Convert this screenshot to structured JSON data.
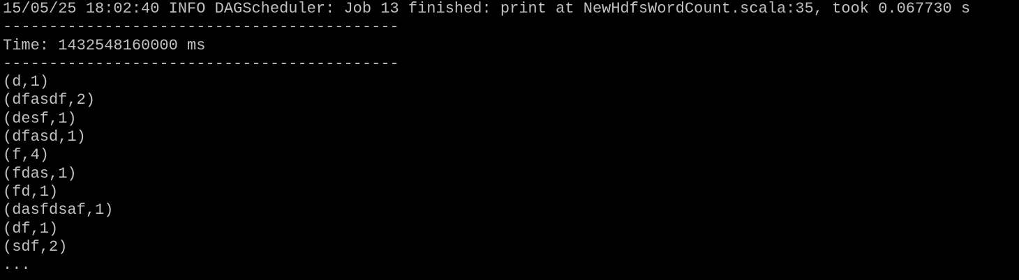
{
  "terminal": {
    "lines": [
      "15/05/25 18:02:40 INFO DAGScheduler: Job 13 finished: print at NewHdfsWordCount.scala:35, took 0.067730 s",
      "-------------------------------------------",
      "Time: 1432548160000 ms",
      "-------------------------------------------",
      "(d,1)",
      "(dfasdf,2)",
      "(desf,1)",
      "(dfasd,1)",
      "(f,4)",
      "(fdas,1)",
      "(fd,1)",
      "(dasfdsaf,1)",
      "(df,1)",
      "(sdf,2)",
      "..."
    ],
    "colors": {
      "background": "#000000",
      "foreground": "#c0c0c0"
    }
  }
}
